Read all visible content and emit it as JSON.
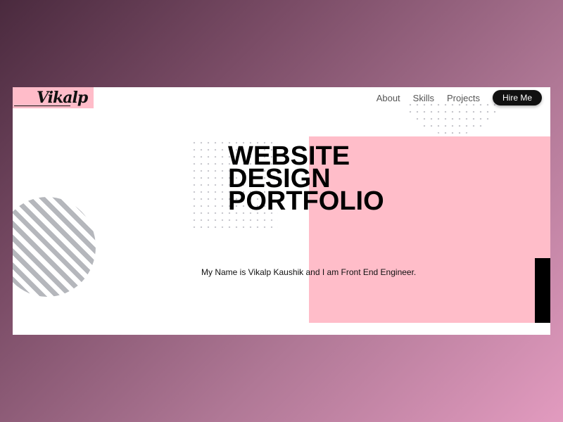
{
  "logo": {
    "text": "Vikalp"
  },
  "nav": {
    "links": [
      "About",
      "Skills",
      "Projects"
    ],
    "cta": "Hire Me"
  },
  "hero": {
    "headline": [
      "WEBSITE",
      "DESIGN",
      "PORTFOLIO"
    ],
    "tagline": "My Name is Vikalp Kaushik and I am Front End Engineer."
  },
  "colors": {
    "accent_pink": "#ffbdc9",
    "text_dark": "#000000",
    "stripe_gray": "#b5b7bc"
  }
}
